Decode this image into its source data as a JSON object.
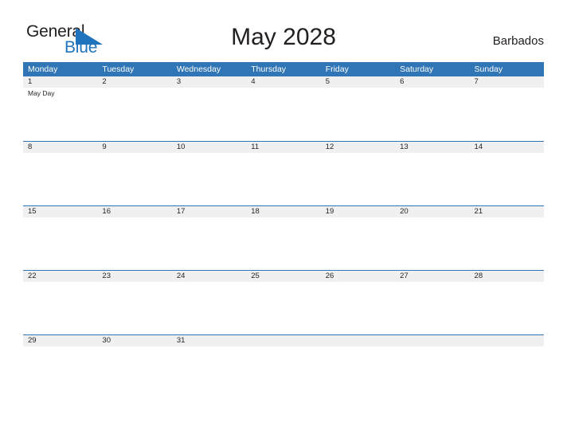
{
  "brand": {
    "word_one": "General",
    "word_two": "Blue",
    "triangle_icon": "triangle-icon",
    "accent_color": "#1f74bd"
  },
  "header": {
    "title": "May 2028",
    "country": "Barbados"
  },
  "calendar": {
    "header_color": "#3075b5",
    "band_color": "#f0f0f0",
    "weekdays": [
      "Monday",
      "Tuesday",
      "Wednesday",
      "Thursday",
      "Friday",
      "Saturday",
      "Sunday"
    ],
    "weeks": [
      [
        {
          "day": "1",
          "events": [
            "May Day"
          ]
        },
        {
          "day": "2",
          "events": []
        },
        {
          "day": "3",
          "events": []
        },
        {
          "day": "4",
          "events": []
        },
        {
          "day": "5",
          "events": []
        },
        {
          "day": "6",
          "events": []
        },
        {
          "day": "7",
          "events": []
        }
      ],
      [
        {
          "day": "8",
          "events": []
        },
        {
          "day": "9",
          "events": []
        },
        {
          "day": "10",
          "events": []
        },
        {
          "day": "11",
          "events": []
        },
        {
          "day": "12",
          "events": []
        },
        {
          "day": "13",
          "events": []
        },
        {
          "day": "14",
          "events": []
        }
      ],
      [
        {
          "day": "15",
          "events": []
        },
        {
          "day": "16",
          "events": []
        },
        {
          "day": "17",
          "events": []
        },
        {
          "day": "18",
          "events": []
        },
        {
          "day": "19",
          "events": []
        },
        {
          "day": "20",
          "events": []
        },
        {
          "day": "21",
          "events": []
        }
      ],
      [
        {
          "day": "22",
          "events": []
        },
        {
          "day": "23",
          "events": []
        },
        {
          "day": "24",
          "events": []
        },
        {
          "day": "25",
          "events": []
        },
        {
          "day": "26",
          "events": []
        },
        {
          "day": "27",
          "events": []
        },
        {
          "day": "28",
          "events": []
        }
      ],
      [
        {
          "day": "29",
          "events": []
        },
        {
          "day": "30",
          "events": []
        },
        {
          "day": "31",
          "events": []
        },
        {
          "day": "",
          "events": []
        },
        {
          "day": "",
          "events": []
        },
        {
          "day": "",
          "events": []
        },
        {
          "day": "",
          "events": []
        }
      ]
    ]
  }
}
